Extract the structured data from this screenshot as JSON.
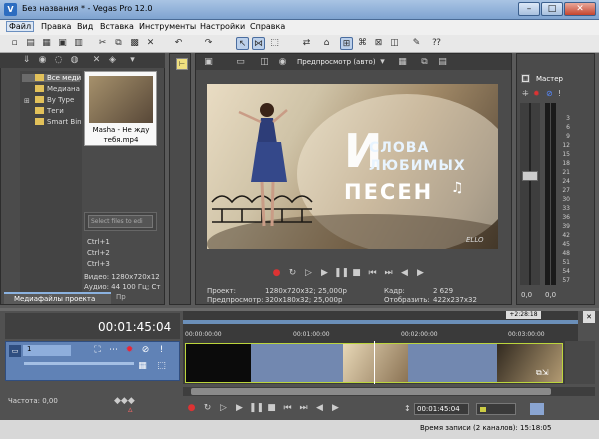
{
  "app": {
    "title": "Без названия * - Vegas Pro 12.0"
  },
  "menu": {
    "items": [
      "Файл",
      "Правка",
      "Вид",
      "Вставка",
      "Инструменты",
      "Настройки",
      "Справка"
    ]
  },
  "explorer": {
    "tree": [
      "Все меди",
      "Медиана",
      "By Type",
      "Теги",
      "Smart Bin"
    ],
    "media_item": "Masha - Не жду тебя.mp4",
    "tags_placeholder": "Select files to edi",
    "shortcuts": [
      "Ctrl+1",
      "Ctrl+2",
      "Ctrl+3"
    ],
    "video_info": "Видео: 1280x720x12",
    "audio_info": "Аудио: 44 100 Гц; Ст",
    "tab_active": "Медиафайлы проекта",
    "tab_other": "Пр"
  },
  "preview": {
    "mode": "Предпросмотр (авто)",
    "overlay_line1": "СЛОВА",
    "overlay_line2": "ЛЮБИМЫХ",
    "overlay_line3": "ПЕСЕН",
    "overlay_initial": "И",
    "watermark": "ELLO",
    "info": {
      "project_label": "Проект:",
      "project_value": "1280x720x32; 25,000p",
      "preview_label": "Предпросмотр:",
      "preview_value": "320x180x32; 25,000p",
      "frame_label": "Кадр:",
      "frame_value": "2 629",
      "display_label": "Отобразить:",
      "display_value": "422x237x32"
    }
  },
  "master": {
    "label": "Мастер",
    "scale": [
      "3",
      "6",
      "9",
      "12",
      "15",
      "18",
      "21",
      "24",
      "27",
      "30",
      "33",
      "36",
      "39",
      "42",
      "45",
      "48",
      "51",
      "54",
      "57"
    ],
    "value_left": "0,0",
    "value_right": "0,0"
  },
  "timeline": {
    "timecode": "00:01:45:04",
    "ruler": [
      "00:00:00:00",
      "00:01:00:00",
      "00:02:00:00",
      "00:03:00:00"
    ],
    "marker": "+2:28:18",
    "track_number": "1",
    "rate_label": "Частота: 0,00",
    "transport_timecode": "00:01:45:04",
    "status": "Время записи (2 каналов): 15:18:05"
  }
}
